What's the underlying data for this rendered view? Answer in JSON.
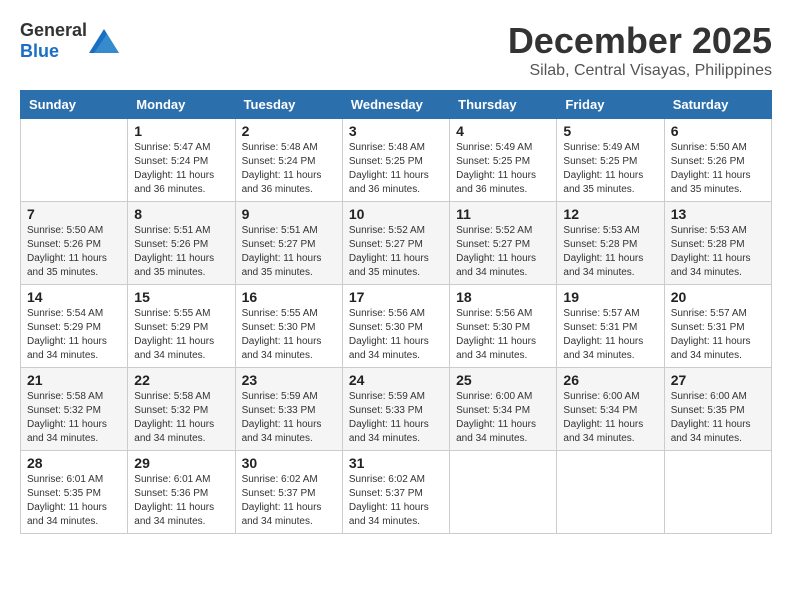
{
  "header": {
    "logo_general": "General",
    "logo_blue": "Blue",
    "month_title": "December 2025",
    "location": "Silab, Central Visayas, Philippines"
  },
  "weekdays": [
    "Sunday",
    "Monday",
    "Tuesday",
    "Wednesday",
    "Thursday",
    "Friday",
    "Saturday"
  ],
  "weeks": [
    [
      {
        "day": "",
        "sunrise": "",
        "sunset": "",
        "daylight": ""
      },
      {
        "day": "1",
        "sunrise": "Sunrise: 5:47 AM",
        "sunset": "Sunset: 5:24 PM",
        "daylight": "Daylight: 11 hours and 36 minutes."
      },
      {
        "day": "2",
        "sunrise": "Sunrise: 5:48 AM",
        "sunset": "Sunset: 5:24 PM",
        "daylight": "Daylight: 11 hours and 36 minutes."
      },
      {
        "day": "3",
        "sunrise": "Sunrise: 5:48 AM",
        "sunset": "Sunset: 5:25 PM",
        "daylight": "Daylight: 11 hours and 36 minutes."
      },
      {
        "day": "4",
        "sunrise": "Sunrise: 5:49 AM",
        "sunset": "Sunset: 5:25 PM",
        "daylight": "Daylight: 11 hours and 36 minutes."
      },
      {
        "day": "5",
        "sunrise": "Sunrise: 5:49 AM",
        "sunset": "Sunset: 5:25 PM",
        "daylight": "Daylight: 11 hours and 35 minutes."
      },
      {
        "day": "6",
        "sunrise": "Sunrise: 5:50 AM",
        "sunset": "Sunset: 5:26 PM",
        "daylight": "Daylight: 11 hours and 35 minutes."
      }
    ],
    [
      {
        "day": "7",
        "sunrise": "Sunrise: 5:50 AM",
        "sunset": "Sunset: 5:26 PM",
        "daylight": "Daylight: 11 hours and 35 minutes."
      },
      {
        "day": "8",
        "sunrise": "Sunrise: 5:51 AM",
        "sunset": "Sunset: 5:26 PM",
        "daylight": "Daylight: 11 hours and 35 minutes."
      },
      {
        "day": "9",
        "sunrise": "Sunrise: 5:51 AM",
        "sunset": "Sunset: 5:27 PM",
        "daylight": "Daylight: 11 hours and 35 minutes."
      },
      {
        "day": "10",
        "sunrise": "Sunrise: 5:52 AM",
        "sunset": "Sunset: 5:27 PM",
        "daylight": "Daylight: 11 hours and 35 minutes."
      },
      {
        "day": "11",
        "sunrise": "Sunrise: 5:52 AM",
        "sunset": "Sunset: 5:27 PM",
        "daylight": "Daylight: 11 hours and 34 minutes."
      },
      {
        "day": "12",
        "sunrise": "Sunrise: 5:53 AM",
        "sunset": "Sunset: 5:28 PM",
        "daylight": "Daylight: 11 hours and 34 minutes."
      },
      {
        "day": "13",
        "sunrise": "Sunrise: 5:53 AM",
        "sunset": "Sunset: 5:28 PM",
        "daylight": "Daylight: 11 hours and 34 minutes."
      }
    ],
    [
      {
        "day": "14",
        "sunrise": "Sunrise: 5:54 AM",
        "sunset": "Sunset: 5:29 PM",
        "daylight": "Daylight: 11 hours and 34 minutes."
      },
      {
        "day": "15",
        "sunrise": "Sunrise: 5:55 AM",
        "sunset": "Sunset: 5:29 PM",
        "daylight": "Daylight: 11 hours and 34 minutes."
      },
      {
        "day": "16",
        "sunrise": "Sunrise: 5:55 AM",
        "sunset": "Sunset: 5:30 PM",
        "daylight": "Daylight: 11 hours and 34 minutes."
      },
      {
        "day": "17",
        "sunrise": "Sunrise: 5:56 AM",
        "sunset": "Sunset: 5:30 PM",
        "daylight": "Daylight: 11 hours and 34 minutes."
      },
      {
        "day": "18",
        "sunrise": "Sunrise: 5:56 AM",
        "sunset": "Sunset: 5:30 PM",
        "daylight": "Daylight: 11 hours and 34 minutes."
      },
      {
        "day": "19",
        "sunrise": "Sunrise: 5:57 AM",
        "sunset": "Sunset: 5:31 PM",
        "daylight": "Daylight: 11 hours and 34 minutes."
      },
      {
        "day": "20",
        "sunrise": "Sunrise: 5:57 AM",
        "sunset": "Sunset: 5:31 PM",
        "daylight": "Daylight: 11 hours and 34 minutes."
      }
    ],
    [
      {
        "day": "21",
        "sunrise": "Sunrise: 5:58 AM",
        "sunset": "Sunset: 5:32 PM",
        "daylight": "Daylight: 11 hours and 34 minutes."
      },
      {
        "day": "22",
        "sunrise": "Sunrise: 5:58 AM",
        "sunset": "Sunset: 5:32 PM",
        "daylight": "Daylight: 11 hours and 34 minutes."
      },
      {
        "day": "23",
        "sunrise": "Sunrise: 5:59 AM",
        "sunset": "Sunset: 5:33 PM",
        "daylight": "Daylight: 11 hours and 34 minutes."
      },
      {
        "day": "24",
        "sunrise": "Sunrise: 5:59 AM",
        "sunset": "Sunset: 5:33 PM",
        "daylight": "Daylight: 11 hours and 34 minutes."
      },
      {
        "day": "25",
        "sunrise": "Sunrise: 6:00 AM",
        "sunset": "Sunset: 5:34 PM",
        "daylight": "Daylight: 11 hours and 34 minutes."
      },
      {
        "day": "26",
        "sunrise": "Sunrise: 6:00 AM",
        "sunset": "Sunset: 5:34 PM",
        "daylight": "Daylight: 11 hours and 34 minutes."
      },
      {
        "day": "27",
        "sunrise": "Sunrise: 6:00 AM",
        "sunset": "Sunset: 5:35 PM",
        "daylight": "Daylight: 11 hours and 34 minutes."
      }
    ],
    [
      {
        "day": "28",
        "sunrise": "Sunrise: 6:01 AM",
        "sunset": "Sunset: 5:35 PM",
        "daylight": "Daylight: 11 hours and 34 minutes."
      },
      {
        "day": "29",
        "sunrise": "Sunrise: 6:01 AM",
        "sunset": "Sunset: 5:36 PM",
        "daylight": "Daylight: 11 hours and 34 minutes."
      },
      {
        "day": "30",
        "sunrise": "Sunrise: 6:02 AM",
        "sunset": "Sunset: 5:37 PM",
        "daylight": "Daylight: 11 hours and 34 minutes."
      },
      {
        "day": "31",
        "sunrise": "Sunrise: 6:02 AM",
        "sunset": "Sunset: 5:37 PM",
        "daylight": "Daylight: 11 hours and 34 minutes."
      },
      {
        "day": "",
        "sunrise": "",
        "sunset": "",
        "daylight": ""
      },
      {
        "day": "",
        "sunrise": "",
        "sunset": "",
        "daylight": ""
      },
      {
        "day": "",
        "sunrise": "",
        "sunset": "",
        "daylight": ""
      }
    ]
  ]
}
